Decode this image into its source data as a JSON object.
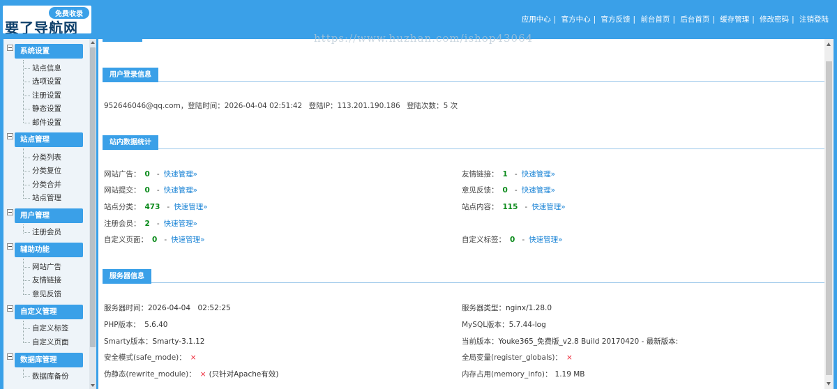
{
  "header": {
    "logo_badge": "免费收录",
    "logo_text": "要了导航网",
    "nav": [
      "应用中心",
      "官方中心",
      "官方反馈",
      "前台首页",
      "后台首页",
      "缓存管理",
      "修改密码",
      "注销登陆"
    ],
    "nav_separator": "|"
  },
  "watermark": "https://www.huzhan.com/ishop43064",
  "sidebar": {
    "groups": [
      {
        "title": "系统设置",
        "items": [
          "站点信息",
          "选项设置",
          "注册设置",
          "静态设置",
          "邮件设置"
        ]
      },
      {
        "title": "站点管理",
        "items": [
          "分类列表",
          "分类复位",
          "分类合并",
          "站点管理"
        ]
      },
      {
        "title": "用户管理",
        "items": [
          "注册会员"
        ]
      },
      {
        "title": "辅助功能",
        "items": [
          "网站广告",
          "友情链接",
          "意见反馈"
        ]
      },
      {
        "title": "自定义管理",
        "items": [
          "自定义标签",
          "自定义页面"
        ]
      },
      {
        "title": "数据库管理",
        "items": [
          "数据库备份"
        ]
      }
    ]
  },
  "login_info": {
    "title": "用户登录信息",
    "email": "952646046@qq.com",
    "time_label": "登陆时间：",
    "time": "2026-04-04 02:51:42",
    "ip_label": "登陆IP：",
    "ip": "113.201.190.186",
    "count_label": "登陆次数：",
    "count": "5 次"
  },
  "stats": {
    "title": "站内数据统计",
    "quick_label": "快速管理»",
    "dash": "-",
    "left": [
      {
        "label": "网站广告：",
        "value": "0"
      },
      {
        "label": "网站提交：",
        "value": "0"
      },
      {
        "label": "站点分类：",
        "value": "473"
      },
      {
        "label": "注册会员：",
        "value": "2"
      },
      {
        "label": "自定义页面：",
        "value": "0"
      }
    ],
    "right": [
      {
        "label": "友情链接：",
        "value": "1"
      },
      {
        "label": "意见反馈：",
        "value": "0"
      },
      {
        "label": "站点内容：",
        "value": "115"
      },
      {
        "label": "自定义标签：",
        "value": "0"
      }
    ]
  },
  "server": {
    "title": "服务器信息",
    "cross": "×",
    "left": [
      {
        "label": "服务器时间：",
        "value": "2026-04-04　02:52:25"
      },
      {
        "label": "PHP版本：",
        "value": "5.6.40"
      },
      {
        "label": "Smarty版本：",
        "value": "Smarty-3.1.12"
      },
      {
        "label": "安全模式(safe_mode)：",
        "value": ""
      },
      {
        "label": "伪静态(rewrite_module)：",
        "value": "(只针对Apache有效)"
      }
    ],
    "right": [
      {
        "label": "服务器类型：",
        "value": "nginx/1.28.0"
      },
      {
        "label": "MySQL版本：",
        "value": "5.7.44-log"
      },
      {
        "label": "当前版本：",
        "value": "Youke365_免费版_v2.8 Build 20170420 - 最新版本:"
      },
      {
        "label": "全局变量(register_globals)：",
        "value": ""
      },
      {
        "label": "内存占用(memory_info)：",
        "value": "1.19 MB"
      }
    ]
  }
}
